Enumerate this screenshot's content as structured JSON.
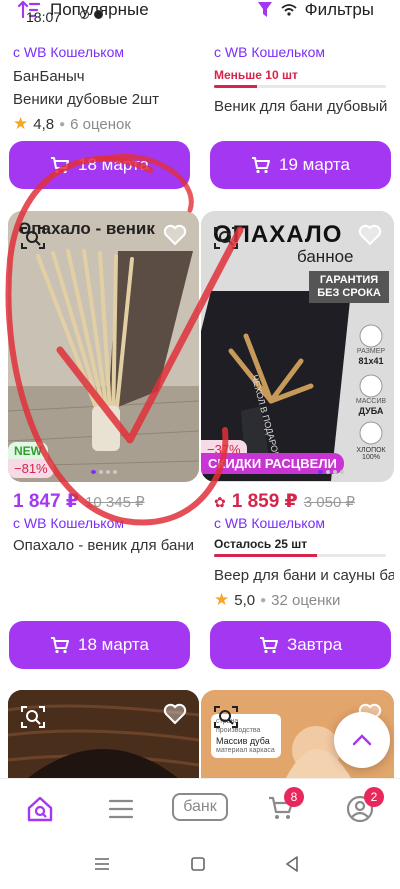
{
  "status_bar": {
    "time": "18:07"
  },
  "toolbar": {
    "sort_label": "Популярные",
    "filters_label": "Фильтры"
  },
  "products": [
    {
      "wallet_text": "с WB Кошельком",
      "brand": "БанБаныч",
      "name": "Веники дубовые 2шт",
      "rating": "4,8",
      "reviews": "6 оценок",
      "delivery_label": "18 марта"
    },
    {
      "wallet_text": "с WB Кошельком",
      "stock_text": "Меньше 10 шт",
      "stock_level": 0.25,
      "name": "Веник для бани дубовый",
      "delivery_label": "19 марта"
    },
    {
      "image_title": "Опахало - веник",
      "badge_new": "NEW",
      "discount": "−81%",
      "price": "1 847 ₽",
      "old_price": "10 345 ₽",
      "wallet_text": "с WB Кошельком",
      "name": "Опахало - веник для бани",
      "delivery_label": "18 марта"
    },
    {
      "image_title": "ОПАХАЛО",
      "image_subtitle": "банное",
      "guarantee": "ГАРАНТИЯ БЕЗ СРОКА",
      "feature_size_label": "РАЗМЕР",
      "feature_size": "81x41",
      "feature_material_label": "МАССИВ",
      "feature_material": "ДУБА",
      "feature_cotton": "ХЛОПОК 100%",
      "case_label": "ЧЕХОЛ В ПОДАРОК",
      "discount": "−37%",
      "promo": "СКИДКИ РАСЦВЕЛИ",
      "price": "1 859 ₽",
      "old_price": "3 050 ₽",
      "wallet_text": "с WB Кошельком",
      "stock_text": "Осталось 25 шт",
      "stock_level": 0.6,
      "name": "Веер для бани и сауны банное",
      "rating": "5,0",
      "reviews": "32 оценки",
      "delivery_label": "Завтра"
    },
    {
      "image_hint": ""
    },
    {
      "chip_line1": "страна",
      "chip_line2": "производства",
      "chip_line3": "Массив дуба",
      "chip_line4": "материал каркаса"
    }
  ],
  "bottom_nav": {
    "bank_label": "банк",
    "cart_count": "8",
    "profile_count": "2"
  },
  "colors": {
    "accent": "#a437f2",
    "sale": "#d6244b",
    "promo": "#c934d4"
  }
}
